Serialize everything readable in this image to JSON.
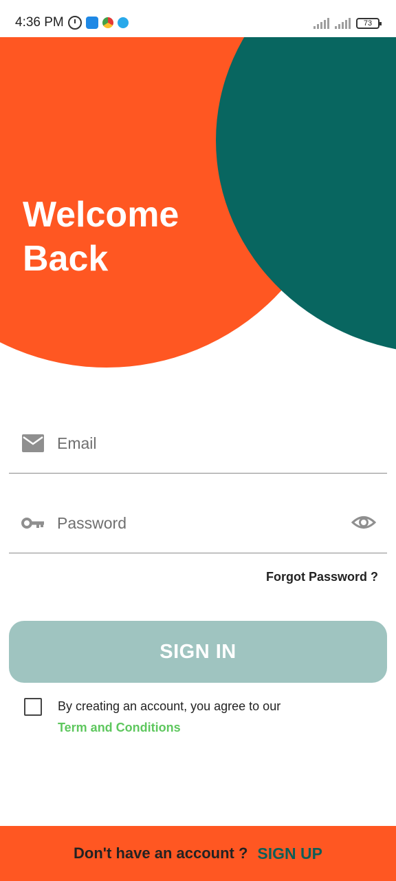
{
  "status_bar": {
    "time": "4:36 PM",
    "battery": "73"
  },
  "header": {
    "title_line1": "Welcome",
    "title_line2": "Back"
  },
  "form": {
    "email_placeholder": "Email",
    "password_placeholder": "Password",
    "forgot_password": "Forgot Password ?",
    "sign_in": "SIGN IN",
    "agree_text": "By creating an account, you agree to our",
    "terms_link": "Term and Conditions"
  },
  "footer": {
    "prompt": "Don't have an account ?",
    "sign_up": "SIGN UP"
  },
  "icons": {
    "email": "mail-icon",
    "password": "key-icon",
    "visibility": "eye-icon"
  },
  "colors": {
    "accent_orange": "#ff5722",
    "accent_teal": "#086660",
    "button_disabled": "#9fc4c0",
    "terms_green": "#5ec75e"
  }
}
